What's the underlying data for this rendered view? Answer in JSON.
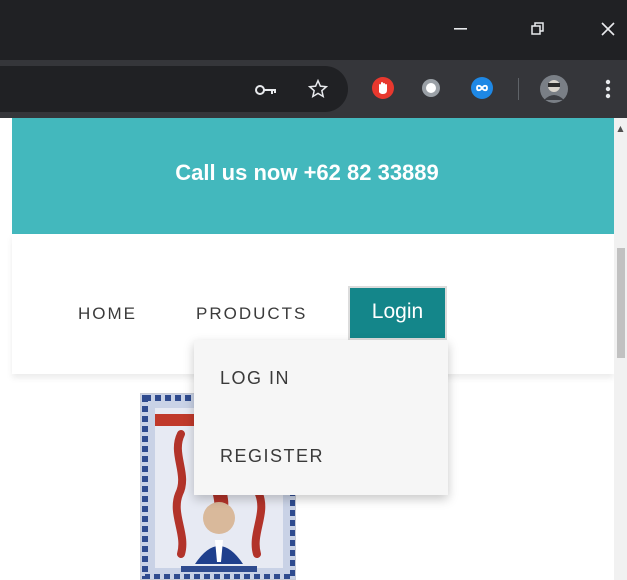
{
  "window": {
    "minimize_icon": "minimize-icon",
    "restore_icon": "restore-icon",
    "close_icon": "close-icon"
  },
  "toolbar": {
    "icons": [
      "key-icon",
      "star-icon",
      "adblock-extension-icon",
      "circle-extension-icon",
      "infinity-extension-icon",
      "profile-avatar",
      "kebab-menu-icon"
    ]
  },
  "banner": {
    "text": "Call us now +62 82 33889",
    "color": "#43b8bd"
  },
  "nav": {
    "home": "HOME",
    "products": "PRODUCTS",
    "login": "Login",
    "login_color": "#14868a"
  },
  "dropdown": {
    "items": [
      {
        "label": "LOG IN"
      },
      {
        "label": "REGISTER"
      }
    ]
  },
  "product": {
    "image": "centipede-poster-image"
  }
}
